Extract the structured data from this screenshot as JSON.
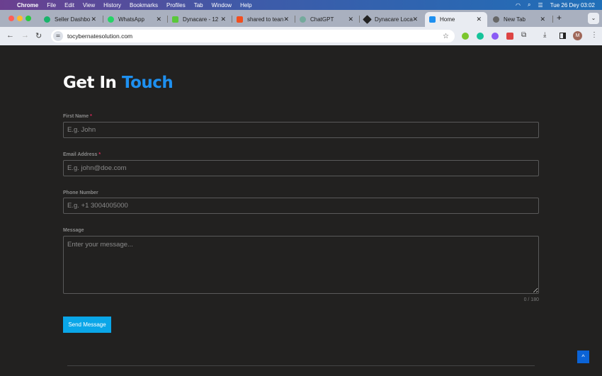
{
  "menubar": {
    "app": "Chrome",
    "items": [
      "File",
      "Edit",
      "View",
      "History",
      "Bookmarks",
      "Profiles",
      "Tab",
      "Window",
      "Help"
    ],
    "clock": "Tue 26 Dey  03:02"
  },
  "tabs": [
    {
      "title": "Seller Dashbo",
      "color": "#19b36b"
    },
    {
      "title": "WhatsApp",
      "color": "#25d366"
    },
    {
      "title": "Dynacare - 12",
      "color": "#5ac83a"
    },
    {
      "title": "shared to tean",
      "color": "#f24e1e"
    },
    {
      "title": "ChatGPT",
      "color": "#74aa9c"
    },
    {
      "title": "Dynacare Loca",
      "color": "#222222"
    },
    {
      "title": "Home",
      "color": "#1e90f0"
    },
    {
      "title": "New Tab",
      "color": "#666666"
    }
  ],
  "address": {
    "url": "tocybernatesolution.com",
    "profile_initial": "M"
  },
  "page": {
    "title_a": "Get In",
    "title_b": "Touch",
    "fields": [
      {
        "label": "First Name",
        "required": "*",
        "placeholder": "E.g. John"
      },
      {
        "label": "Email Address",
        "required": "*",
        "placeholder": "E.g. john@doe.com"
      },
      {
        "label": "Phone Number",
        "placeholder": "E.g. +1 3004005000"
      },
      {
        "label": "Message",
        "placeholder": "Enter your message..."
      }
    ],
    "counter": "0 / 180",
    "send": "Send Message",
    "to_top": "^"
  }
}
